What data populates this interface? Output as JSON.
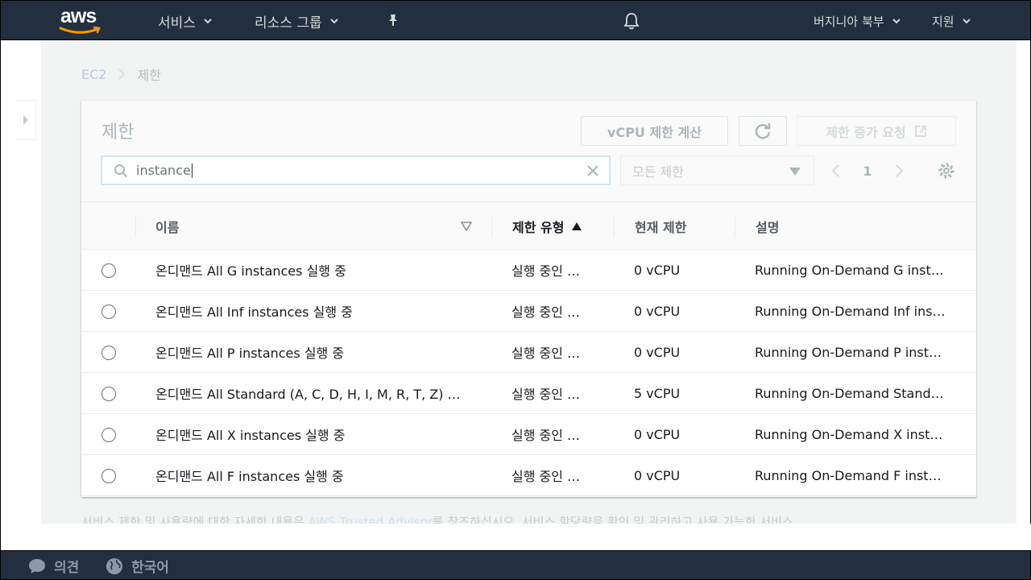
{
  "topnav": {
    "logo_text": "aws",
    "services_label": "서비스",
    "resource_groups_label": "리소스 그룹",
    "region_label": "버지니아 북부",
    "support_label": "지원"
  },
  "breadcrumb": {
    "root": "EC2",
    "current": "제한"
  },
  "panel": {
    "title": "제한",
    "calc_button": "vCPU 제한 계산",
    "request_button": "제한 증가 요청",
    "search_value": "instance",
    "filter_select": "모든 제한",
    "page_number": "1"
  },
  "table": {
    "columns": {
      "name": "이름",
      "type": "제한 유형",
      "current": "현재 제한",
      "description": "설명"
    },
    "rows": [
      {
        "name": "온디맨드 All G instances 실행 중",
        "type": "실행 중인 …",
        "current": "0 vCPU",
        "description": "Running On-Demand G inst…"
      },
      {
        "name": "온디맨드 All Inf instances 실행 중",
        "type": "실행 중인 …",
        "current": "0 vCPU",
        "description": "Running On-Demand Inf ins…"
      },
      {
        "name": "온디맨드 All P instances 실행 중",
        "type": "실행 중인 …",
        "current": "0 vCPU",
        "description": "Running On-Demand P inst…"
      },
      {
        "name": "온디맨드 All Standard (A, C, D, H, I, M, R, T, Z) …",
        "type": "실행 중인 …",
        "current": "5 vCPU",
        "description": "Running On-Demand Stand…"
      },
      {
        "name": "온디맨드 All X instances 실행 중",
        "type": "실행 중인 …",
        "current": "0 vCPU",
        "description": "Running On-Demand X inst…"
      },
      {
        "name": "온디맨드 All F instances 실행 중",
        "type": "실행 중인 …",
        "current": "0 vCPU",
        "description": "Running On-Demand F inst…"
      }
    ]
  },
  "bottom_text": {
    "before": "서비스 제한 및 사용량에 대한 자세한 내용은",
    "link": "AWS Trusted Advisor",
    "after": "를 참조하십시오. 서비스 할당량을 확인 및 관리하고 사용 가능한 서비스"
  },
  "footer": {
    "feedback_label": "의견",
    "language_label": "한국어"
  }
}
